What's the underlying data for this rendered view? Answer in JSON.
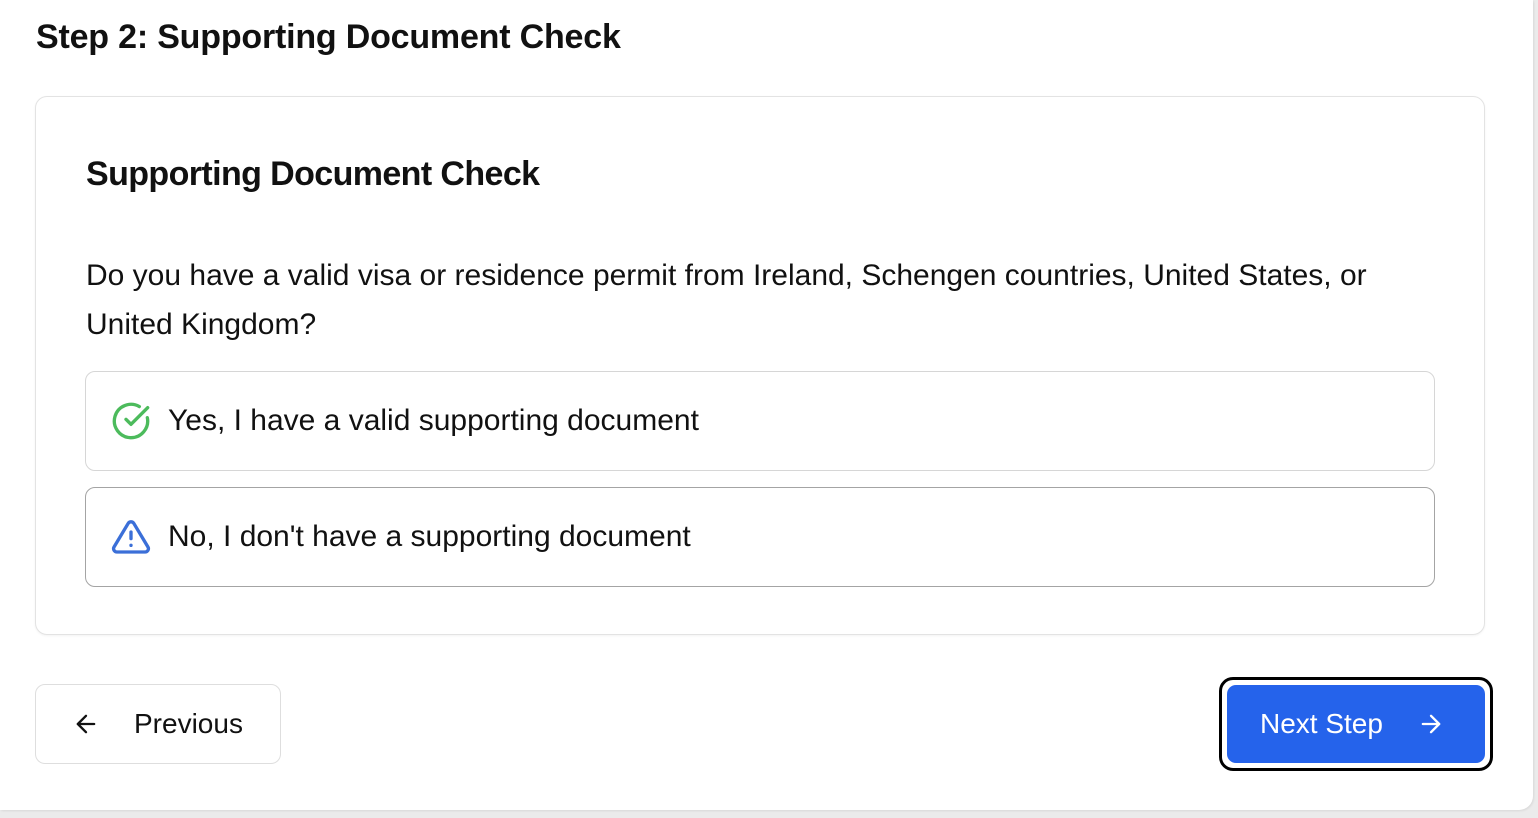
{
  "step_title": "Step 2: Supporting Document Check",
  "card": {
    "title": "Supporting Document Check",
    "question": "Do you have a valid visa or residence permit from Ireland, Schengen countries, United States, or United Kingdom?",
    "options": [
      {
        "label": "Yes, I have a valid supporting document",
        "icon": "check-circle-icon",
        "icon_color": "#4cbb5c"
      },
      {
        "label": "No, I don't have a supporting document",
        "icon": "warning-triangle-icon",
        "icon_color": "#3b6fd8"
      }
    ]
  },
  "navigation": {
    "previous_label": "Previous",
    "previous_icon": "arrow-left-icon",
    "next_label": "Next Step",
    "next_icon": "arrow-right-icon",
    "next_color": "#2563eb"
  }
}
